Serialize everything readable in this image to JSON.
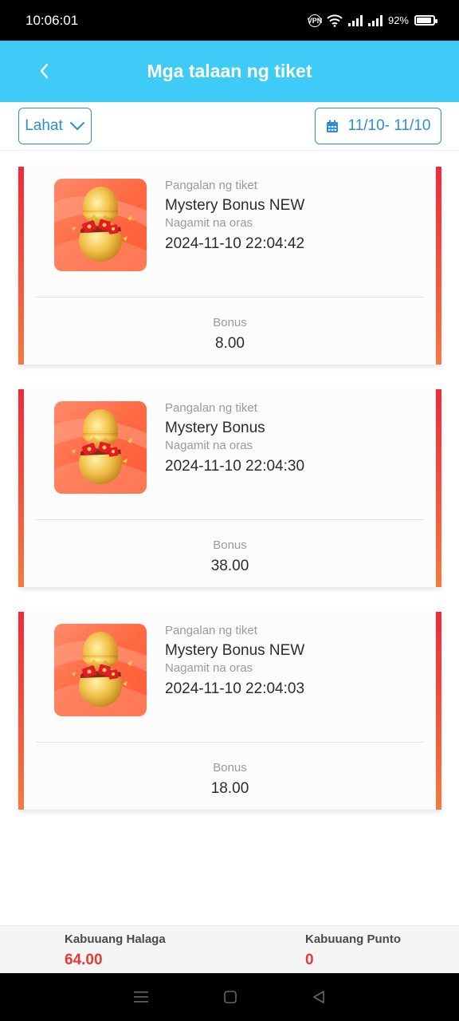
{
  "status_bar": {
    "time": "10:06:01",
    "vpn_label": "VPN",
    "battery_text": "92%"
  },
  "header": {
    "title": "Mga talaan ng tiket",
    "background_color": "#3ecbf7"
  },
  "filters": {
    "type_select": "Lahat",
    "date_range": "11/10- 11/10",
    "accent_color": "#2b8fd4"
  },
  "tickets": [
    {
      "name_label": "Pangalan ng tiket",
      "name": "Mystery Bonus NEW",
      "time_label": "Nagamit na oras",
      "time": "2024-11-10 22:04:42",
      "bonus_label": "Bonus",
      "bonus": "8.00",
      "image": "golden-egg-icon"
    },
    {
      "name_label": "Pangalan ng tiket",
      "name": "Mystery Bonus",
      "time_label": "Nagamit na oras",
      "time": "2024-11-10 22:04:30",
      "bonus_label": "Bonus",
      "bonus": "38.00",
      "image": "golden-egg-icon"
    },
    {
      "name_label": "Pangalan ng tiket",
      "name": "Mystery Bonus NEW",
      "time_label": "Nagamit na oras",
      "time": "2024-11-10 22:04:03",
      "bonus_label": "Bonus",
      "bonus": "18.00",
      "image": "golden-egg-icon"
    }
  ],
  "summary": {
    "total_amount_label": "Kabuuang Halaga",
    "total_amount": "64.00",
    "total_points_label": "Kabuuang Punto",
    "total_points": "0",
    "value_color": "#e53a35"
  },
  "nav": {
    "icons": [
      "menu-icon",
      "home-icon",
      "back-icon"
    ]
  }
}
